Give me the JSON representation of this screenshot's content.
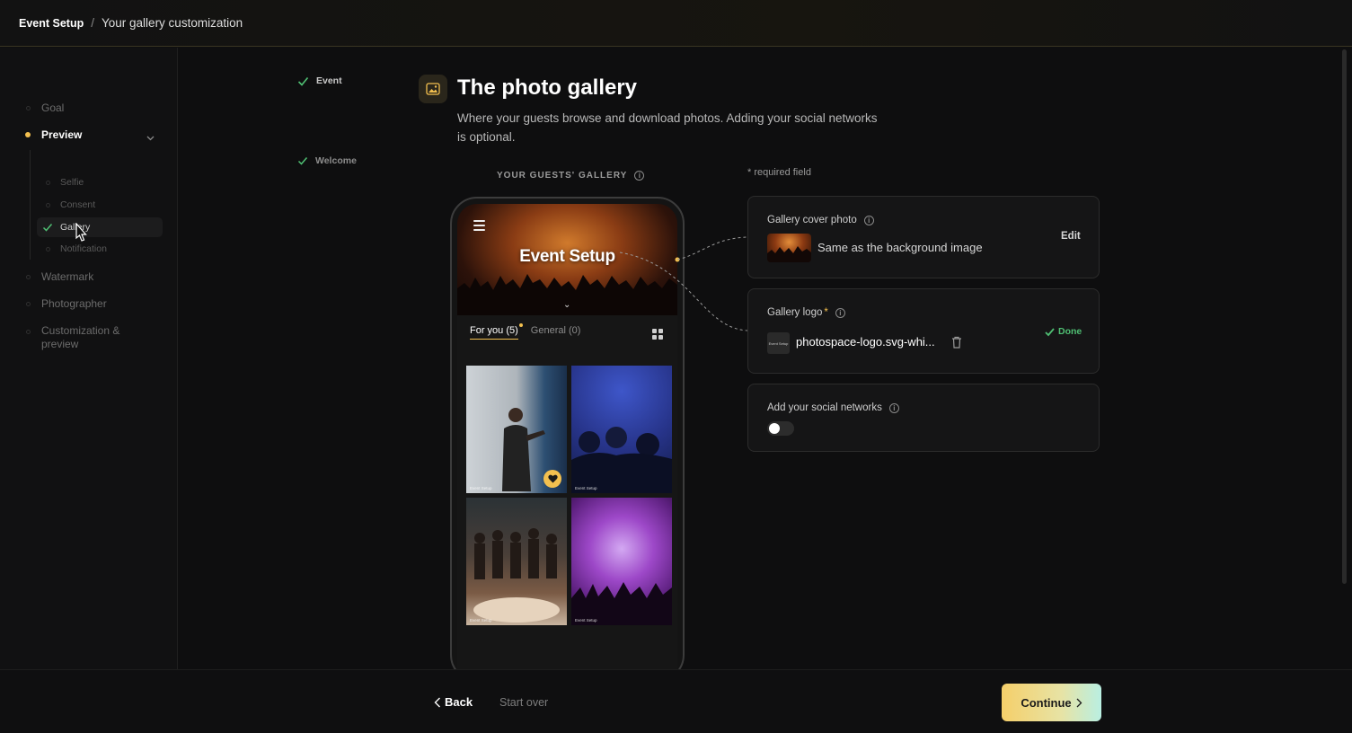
{
  "breadcrumb": {
    "parent": "Event Setup",
    "separator": "/",
    "current": "Your gallery customization"
  },
  "sidebar": {
    "steps": [
      {
        "label": "Event",
        "state": "done"
      },
      {
        "label": "Goal",
        "state": "pending"
      },
      {
        "label": "Preview",
        "state": "active"
      },
      {
        "label": "Watermark",
        "state": "pending"
      },
      {
        "label": "Photographer",
        "state": "pending"
      },
      {
        "label": "Customization & preview",
        "state": "pending"
      }
    ],
    "substeps": [
      {
        "label": "Welcome",
        "state": "done"
      },
      {
        "label": "Selfie",
        "state": "pending"
      },
      {
        "label": "Consent",
        "state": "pending"
      },
      {
        "label": "Gallery",
        "state": "current"
      },
      {
        "label": "Notification",
        "state": "pending"
      }
    ]
  },
  "main": {
    "title": "The photo gallery",
    "subtitle": "Where your guests browse and download photos. Adding your social networks is optional.",
    "gallery_label": "YOUR GUESTS' GALLERY",
    "required_note": "* required field"
  },
  "phone": {
    "cover_title": "Event Setup",
    "tabs": [
      {
        "label": "For you (5)"
      },
      {
        "label": "General (0)"
      }
    ],
    "photo_watermark": "Event Setup"
  },
  "cards": {
    "cover": {
      "label": "Gallery cover photo",
      "value": "Same as the background image",
      "action": "Edit"
    },
    "logo": {
      "label": "Gallery logo",
      "required_mark": "*",
      "filename": "photospace-logo.svg-whi...",
      "thumb_text": "Event Setup",
      "status": "Done"
    },
    "social": {
      "label": "Add your social networks",
      "enabled": false
    }
  },
  "footer": {
    "back_label": "Back",
    "start_over_label": "Start over",
    "continue_label": "Continue"
  },
  "colors": {
    "accent": "#f3c04f",
    "success": "#4fbf73",
    "background": "#0e0e0f"
  },
  "icons": [
    "check-icon",
    "chevron-down-icon",
    "image-icon",
    "info-icon",
    "hamburger-icon",
    "grid-view-icon",
    "heart-icon",
    "trash-icon",
    "chevron-left-icon",
    "chevron-right-icon"
  ]
}
